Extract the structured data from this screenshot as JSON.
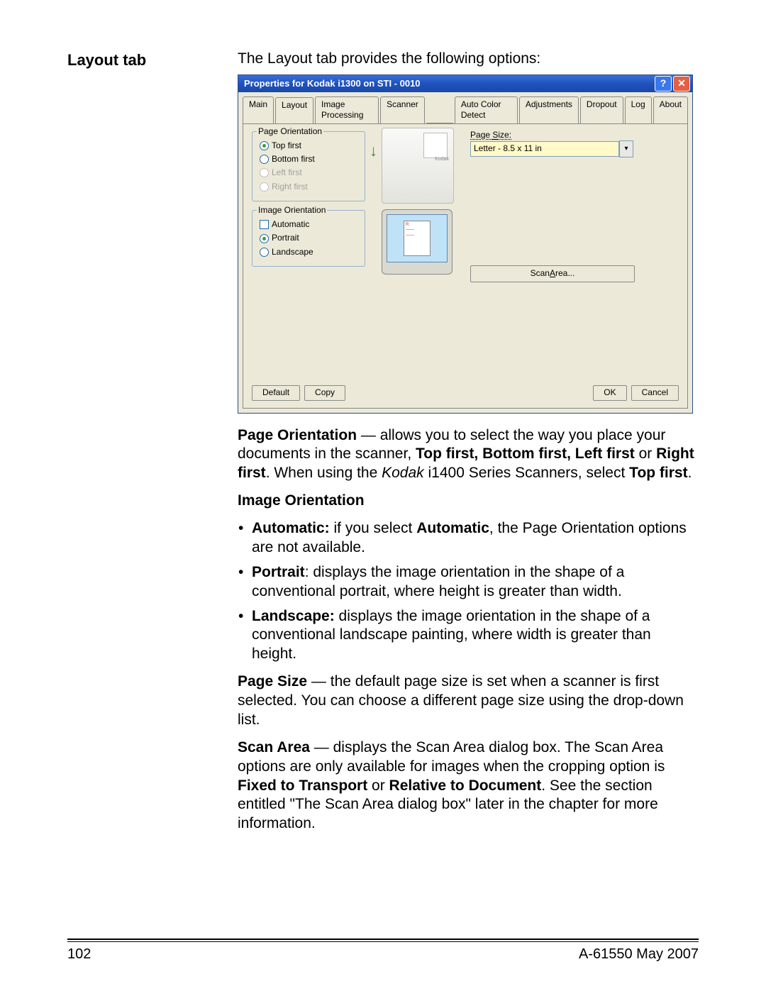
{
  "heading": "Layout tab",
  "intro": "The Layout tab provides the following options:",
  "dialog": {
    "title": "Properties for Kodak i1300 on STI - 0010",
    "tabs": [
      "Main",
      "Layout",
      "Image Processing",
      "Scanner",
      "Auto Color Detect",
      "Adjustments",
      "Dropout",
      "Log",
      "About"
    ],
    "active_tab": "Layout",
    "group_page_orientation": {
      "label": "Page Orientation",
      "options": [
        {
          "label": "Top first",
          "selected": true,
          "disabled": false
        },
        {
          "label": "Bottom first",
          "selected": false,
          "disabled": false
        },
        {
          "label": "Left first",
          "selected": false,
          "disabled": true
        },
        {
          "label": "Right first",
          "selected": false,
          "disabled": true
        }
      ]
    },
    "group_image_orientation": {
      "label": "Image Orientation",
      "options": [
        {
          "kind": "check",
          "label": "Automatic",
          "selected": false
        },
        {
          "kind": "radio",
          "label": "Portrait",
          "selected": true
        },
        {
          "kind": "radio",
          "label": "Landscape",
          "selected": false
        }
      ]
    },
    "page_size": {
      "label": "Page Size:",
      "value": "Letter - 8.5 x 11 in"
    },
    "scan_area_btn": "Scan Area...",
    "buttons": {
      "default": "Default",
      "copy": "Copy",
      "ok": "OK",
      "cancel": "Cancel"
    }
  },
  "body": {
    "p1_prefix": "Page Orientation",
    "p1": " — allows you to select the way you place your documents in the scanner, ",
    "p1_bold": "Top first, Bottom first, Left first",
    "p1_mid": " or ",
    "p1_bold2": "Right first",
    "p1_after": ". When using the ",
    "p1_italic": "Kodak",
    "p1_tail": " i1400 Series Scanners, select ",
    "p1_bold3": "Top first",
    "p1_end": ".",
    "h2": "Image Orientation",
    "li1_b": "Automatic:",
    "li1": " if you select ",
    "li1_b2": "Automatic",
    "li1_t": ", the Page Orientation options are not available.",
    "li2_b": "Portrait",
    "li2": ": displays the image orientation in the shape of a conventional portrait, where height is greater than width.",
    "li3_b": "Landscape:",
    "li3": " displays the image orientation in the shape of a conventional landscape painting, where width is greater than height.",
    "p2_b": "Page Size",
    "p2": " — the default page size is set when a scanner is first selected. You can choose a different page size using the drop-down list.",
    "p3_b": "Scan Area",
    "p3_1": " — displays the Scan Area dialog box. The Scan Area options are only available for images when the cropping option is ",
    "p3_b2": "Fixed to Transport",
    "p3_2": " or ",
    "p3_b3": "Relative to Document",
    "p3_3": ". See the section entitled \"The Scan Area dialog box\" later in the chapter for more information."
  },
  "footer": {
    "page": "102",
    "doc": "A-61550 May 2007"
  }
}
